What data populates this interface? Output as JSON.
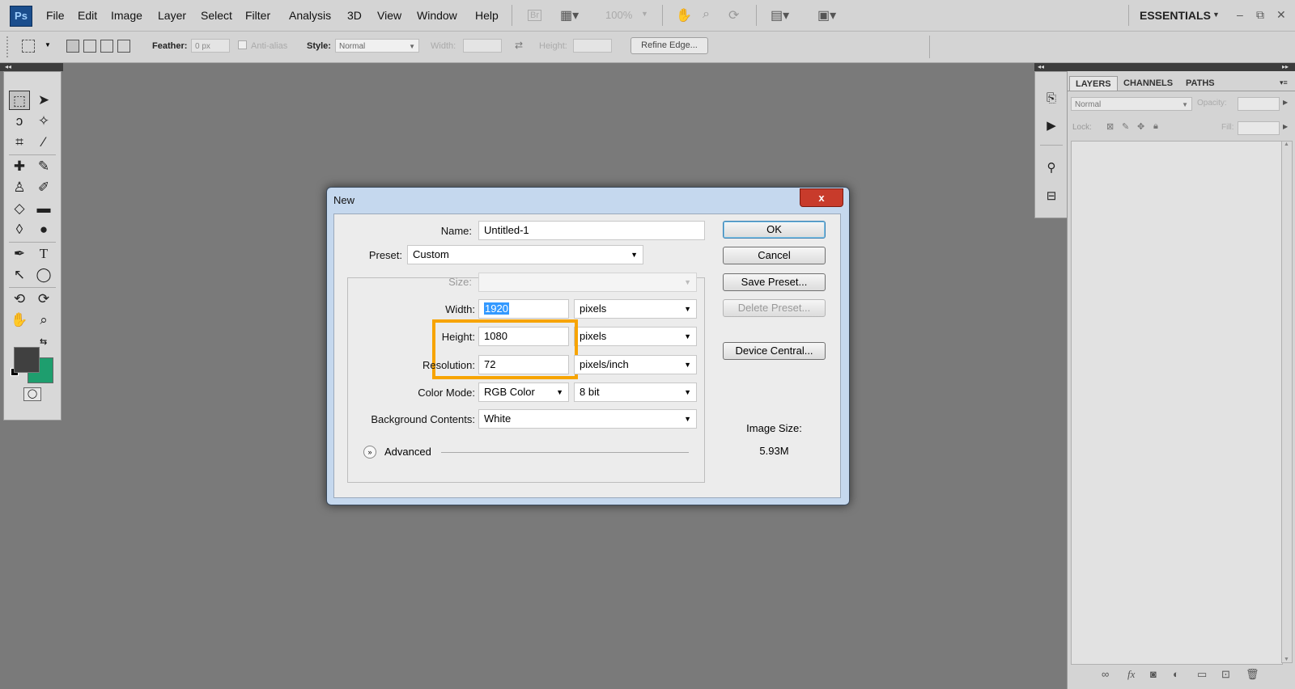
{
  "app": {
    "logo": "Ps",
    "workspace": "ESSENTIALS",
    "zoom": "100%"
  },
  "menu": [
    "File",
    "Edit",
    "Image",
    "Layer",
    "Select",
    "Filter",
    "Analysis",
    "3D",
    "View",
    "Window",
    "Help"
  ],
  "options_bar": {
    "feather_label": "Feather:",
    "feather_value": "0 px",
    "antialias_label": "Anti-alias",
    "style_label": "Style:",
    "style_value": "Normal",
    "width_label": "Width:",
    "height_label": "Height:",
    "refine_edge": "Refine Edge..."
  },
  "panels": {
    "tabs": [
      "LAYERS",
      "CHANNELS",
      "PATHS"
    ],
    "blend_mode": "Normal",
    "opacity_label": "Opacity:",
    "lock_label": "Lock:",
    "fill_label": "Fill:"
  },
  "dialog": {
    "title": "New",
    "close": "x",
    "name_label": "Name:",
    "name_value": "Untitled-1",
    "preset_label": "Preset:",
    "preset_value": "Custom",
    "size_label": "Size:",
    "width_label": "Width:",
    "width_value": "1920",
    "width_unit": "pixels",
    "height_label": "Height:",
    "height_value": "1080",
    "height_unit": "pixels",
    "resolution_label": "Resolution:",
    "resolution_value": "72",
    "resolution_unit": "pixels/inch",
    "color_mode_label": "Color Mode:",
    "color_mode_value": "RGB Color",
    "bit_depth": "8 bit",
    "background_label": "Background Contents:",
    "background_value": "White",
    "advanced_label": "Advanced",
    "buttons": {
      "ok": "OK",
      "cancel": "Cancel",
      "save_preset": "Save Preset...",
      "delete_preset": "Delete Preset...",
      "device_central": "Device Central..."
    },
    "image_size_label": "Image Size:",
    "image_size_value": "5.93M"
  },
  "colors": {
    "foreground": "#404040",
    "background": "#1e9e6e",
    "highlight": "#f7a400"
  }
}
